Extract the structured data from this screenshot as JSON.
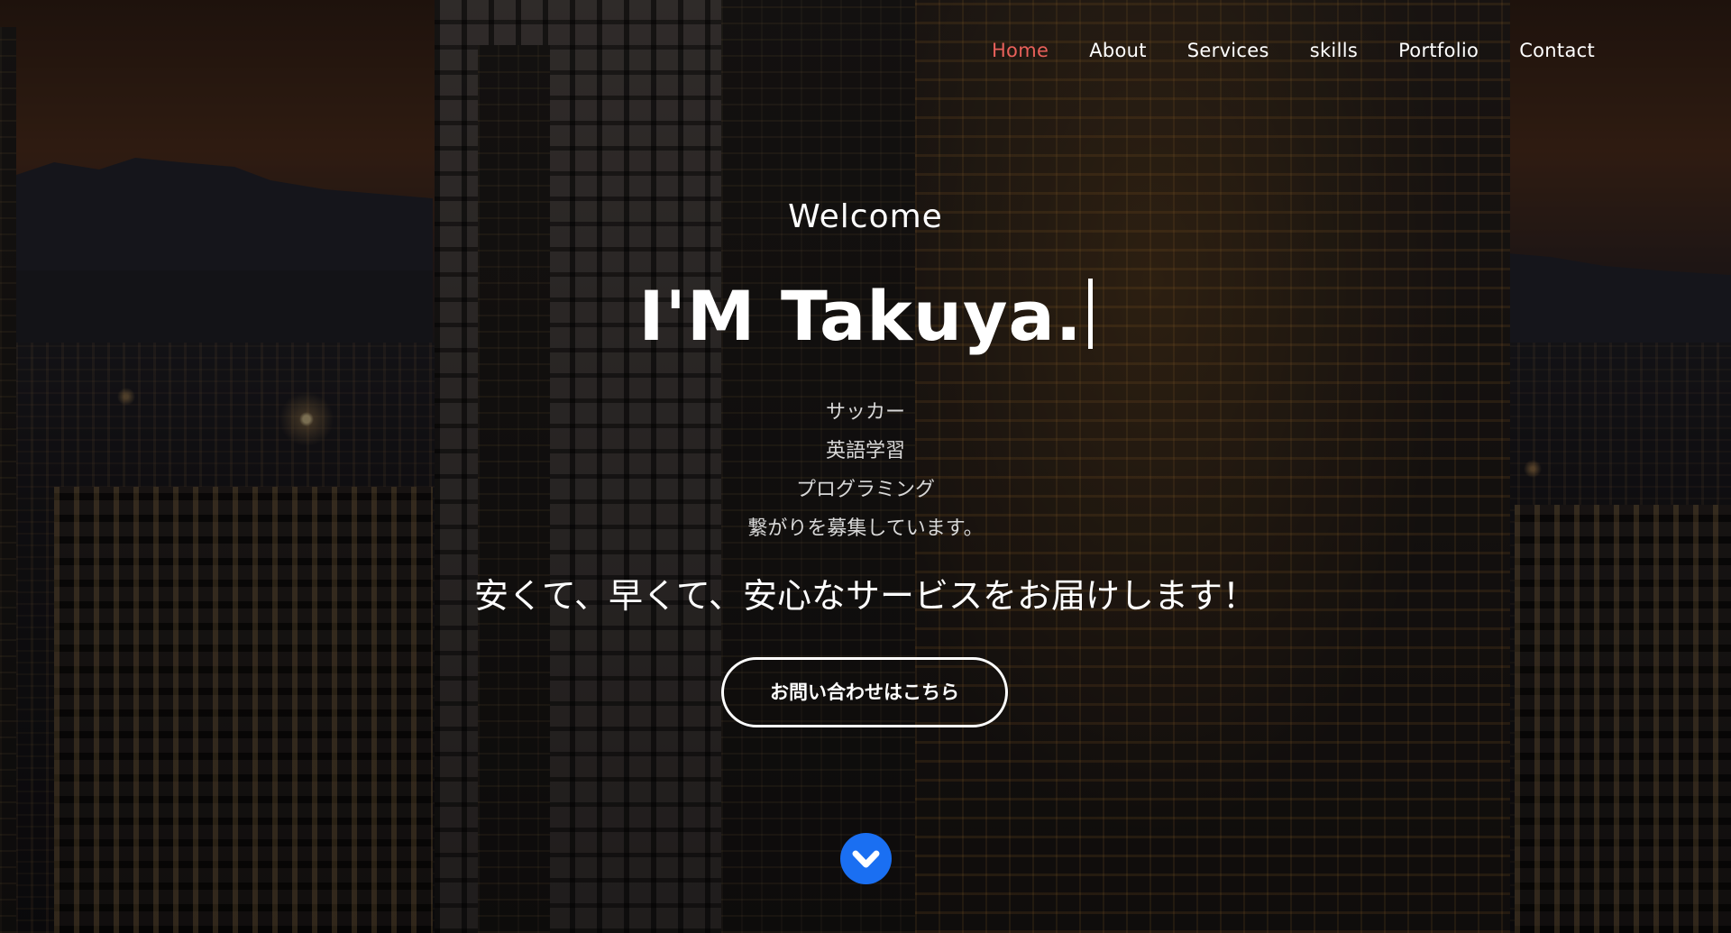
{
  "nav": {
    "items": [
      {
        "label": "Home",
        "active": true
      },
      {
        "label": "About",
        "active": false
      },
      {
        "label": "Services",
        "active": false
      },
      {
        "label": "skills",
        "active": false
      },
      {
        "label": "Portfolio",
        "active": false
      },
      {
        "label": "Contact",
        "active": false
      }
    ],
    "active_color": "#e8605a"
  },
  "hero": {
    "welcome": "Welcome",
    "headline": "I'M Takuya.",
    "interests": [
      "サッカー",
      "英語学習",
      "プログラミング",
      "繋がりを募集しています。"
    ],
    "tagline": "安くて、早くて、安心なサービスをお届けします！",
    "cta_label": "お問い合わせはこちら",
    "scroll_icon": "chevron-down-circle-icon",
    "scroll_color": "#1a6ff2"
  }
}
